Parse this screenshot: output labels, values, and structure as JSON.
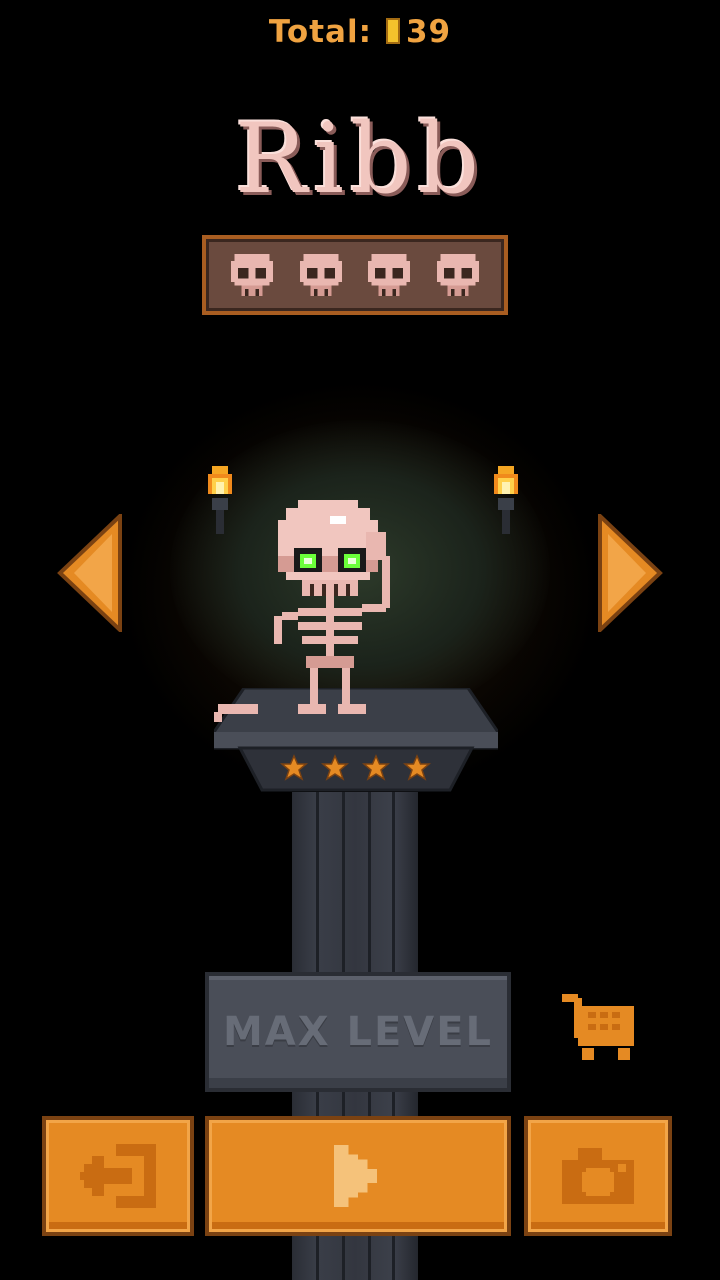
{
  "header": {
    "total_label": "Total:",
    "total_value": "39",
    "coin_icon": "coin-icon"
  },
  "character": {
    "name": "Ribb",
    "level_skulls": 4,
    "stars": 4
  },
  "buttons": {
    "max_level_label": "MAX LEVEL",
    "exit_icon": "exit-icon",
    "play_icon": "play-icon",
    "camera_icon": "camera-icon",
    "shop_icon": "shopping-cart-icon"
  },
  "colors": {
    "accent": "#e58a23",
    "name": "#f1c6bf",
    "eye_glow": "#6bff3a"
  }
}
